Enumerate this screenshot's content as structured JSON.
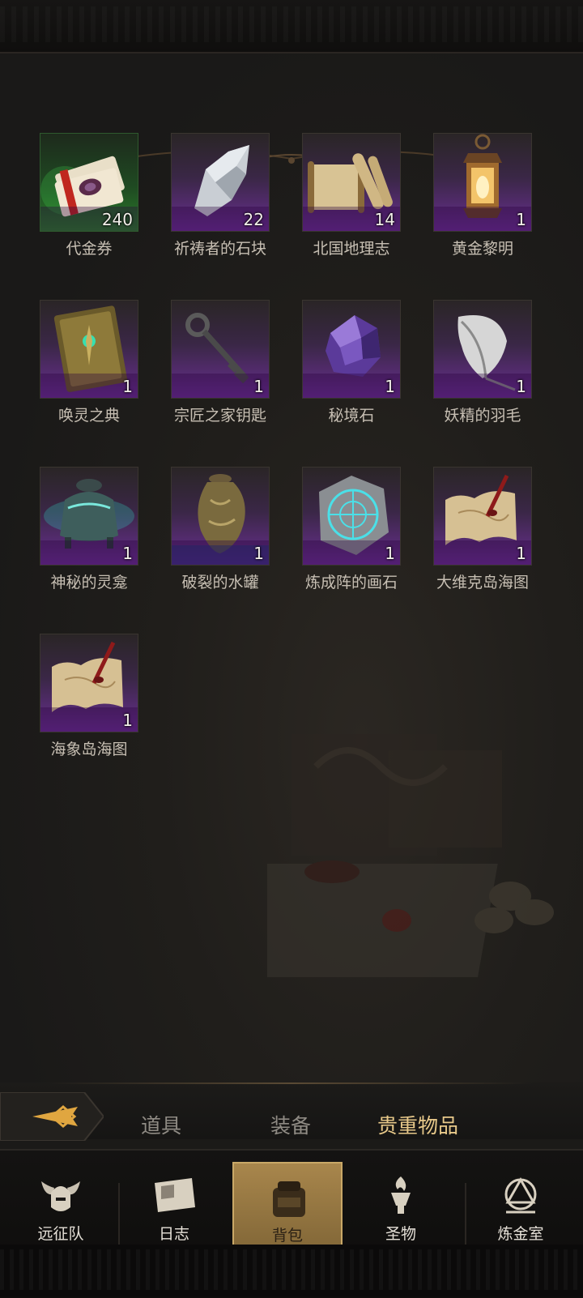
{
  "items": [
    {
      "name": "代金券",
      "qty": "240",
      "rarity": "green",
      "icon": "voucher-bundle-icon"
    },
    {
      "name": "祈祷者的石块",
      "qty": "22",
      "rarity": "purple",
      "icon": "stone-icon"
    },
    {
      "name": "北国地理志",
      "qty": "14",
      "rarity": "purple",
      "icon": "scroll-icon"
    },
    {
      "name": "黄金黎明",
      "qty": "1",
      "rarity": "purple",
      "icon": "lantern-icon"
    },
    {
      "name": "唤灵之典",
      "qty": "1",
      "rarity": "purple",
      "icon": "tome-icon"
    },
    {
      "name": "宗匠之家钥匙",
      "qty": "1",
      "rarity": "purple",
      "icon": "key-icon"
    },
    {
      "name": "秘境石",
      "qty": "1",
      "rarity": "purple",
      "icon": "crystal-icon"
    },
    {
      "name": "妖精的羽毛",
      "qty": "1",
      "rarity": "purple",
      "icon": "feather-icon"
    },
    {
      "name": "神秘的灵龛",
      "qty": "1",
      "rarity": "purple",
      "icon": "shrine-icon"
    },
    {
      "name": "破裂的水罐",
      "qty": "1",
      "rarity": "purple",
      "icon": "jug-icon"
    },
    {
      "name": "炼成阵的画石",
      "qty": "1",
      "rarity": "purple",
      "icon": "rune-stone-icon"
    },
    {
      "name": "大维克岛海图",
      "qty": "1",
      "rarity": "purple",
      "icon": "sea-map-icon"
    },
    {
      "name": "海象岛海图",
      "qty": "1",
      "rarity": "purple",
      "icon": "sea-map-icon"
    }
  ],
  "tabs": {
    "items": "道具",
    "equipment": "装备",
    "valuables": "贵重物品",
    "active": "valuables"
  },
  "nav": {
    "expedition": "远征队",
    "journal": "日志",
    "backpack": "背包",
    "relics": "圣物",
    "alchemy": "炼金室",
    "active": "backpack"
  },
  "colors": {
    "rare_purple": "#6a2f92",
    "uncommon_green": "#2b7d2a",
    "active_gold": "#e8c98a"
  }
}
